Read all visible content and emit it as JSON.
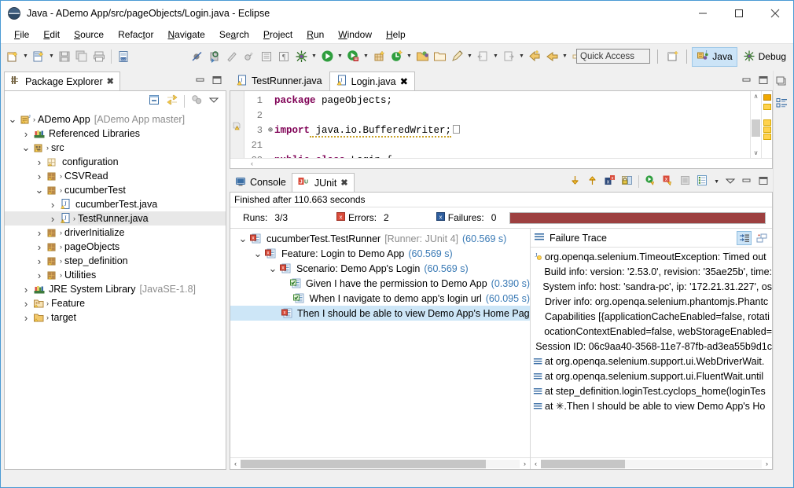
{
  "window": {
    "title": "Java - ADemo App/src/pageObjects/Login.java - Eclipse",
    "app_icon": "eclipse-icon",
    "minimize": "—",
    "maximize": "□",
    "close": "✕"
  },
  "menu": {
    "items": [
      {
        "label": "File",
        "mnemonic": "F"
      },
      {
        "label": "Edit",
        "mnemonic": "E"
      },
      {
        "label": "Source",
        "mnemonic": "S"
      },
      {
        "label": "Refactor",
        "mnemonic": "t"
      },
      {
        "label": "Navigate",
        "mnemonic": "N"
      },
      {
        "label": "Search",
        "mnemonic": "a"
      },
      {
        "label": "Project",
        "mnemonic": "P"
      },
      {
        "label": "Run",
        "mnemonic": "R"
      },
      {
        "label": "Window",
        "mnemonic": "W"
      },
      {
        "label": "Help",
        "mnemonic": "H"
      }
    ]
  },
  "toolbar": {
    "icons": [
      "new-wizard-icon",
      "new-java-class-icon",
      "save-icon",
      "save-all-icon",
      "print-icon",
      "new-java-file-icon",
      "toggle-breakpoint-icon",
      "skip-breakpoints-icon",
      "build-icon",
      "build-all-icon",
      "open-type-icon",
      "open-task-icon",
      "debug-icon",
      "run-icon",
      "run-last-tool-icon",
      "coverage-icon",
      "new-package-icon",
      "open-project-icon",
      "close-project-icon",
      "search-icon",
      "next-annotation-icon",
      "previous-annotation-icon",
      "last-edit-location-icon",
      "back-icon",
      "forward-icon"
    ],
    "quick_access": {
      "placeholder": "Quick Access",
      "value": "Quick Access"
    },
    "open_perspective_icon": "open-perspective-icon",
    "perspectives": [
      {
        "label": "Java",
        "icon": "java-perspective-icon",
        "active": true
      },
      {
        "label": "Debug",
        "icon": "debug-perspective-icon",
        "active": false
      }
    ]
  },
  "package_explorer": {
    "tab": {
      "label": "Package Explorer",
      "icon": "package-explorer-icon",
      "close": "✖"
    },
    "tab_buttons": [
      "minimize-icon",
      "maximize-icon"
    ],
    "toolbar_icons": [
      "collapse-all-icon",
      "link-with-editor-icon",
      "view-menu-filter-icon",
      "view-menu-icon"
    ],
    "tree": [
      {
        "indent": 0,
        "twist": "down",
        "icon": "java-project-icon",
        "arrow": true,
        "label": "ADemo App",
        "sub": "[ADemo App master]",
        "selected": false
      },
      {
        "indent": 1,
        "twist": "right",
        "icon": "referenced-libraries-icon",
        "arrow": false,
        "label": "Referenced Libraries",
        "sub": "",
        "selected": false
      },
      {
        "indent": 1,
        "twist": "down",
        "icon": "source-folder-icon",
        "arrow": true,
        "label": "src",
        "sub": "",
        "selected": false
      },
      {
        "indent": 2,
        "twist": "right",
        "icon": "package-empty-icon",
        "arrow": false,
        "label": "configuration",
        "sub": "",
        "selected": false
      },
      {
        "indent": 2,
        "twist": "right",
        "icon": "package-icon",
        "arrow": true,
        "label": "CSVRead",
        "sub": "",
        "selected": false
      },
      {
        "indent": 2,
        "twist": "down",
        "icon": "package-icon",
        "arrow": true,
        "label": "cucumberTest",
        "sub": "",
        "selected": false
      },
      {
        "indent": 3,
        "twist": "right",
        "icon": "java-file-icon",
        "arrow": false,
        "label": "cucumberTest.java",
        "sub": "",
        "selected": false
      },
      {
        "indent": 3,
        "twist": "right",
        "icon": "java-file-warning-icon",
        "arrow": true,
        "label": "TestRunner.java",
        "sub": "",
        "selected": true
      },
      {
        "indent": 2,
        "twist": "right",
        "icon": "package-icon",
        "arrow": true,
        "label": "driverInitialize",
        "sub": "",
        "selected": false
      },
      {
        "indent": 2,
        "twist": "right",
        "icon": "package-icon",
        "arrow": true,
        "label": "pageObjects",
        "sub": "",
        "selected": false
      },
      {
        "indent": 2,
        "twist": "right",
        "icon": "package-icon",
        "arrow": true,
        "label": "step_definition",
        "sub": "",
        "selected": false
      },
      {
        "indent": 2,
        "twist": "right",
        "icon": "package-icon",
        "arrow": true,
        "label": "Utilities",
        "sub": "",
        "selected": false
      },
      {
        "indent": 1,
        "twist": "right",
        "icon": "jre-library-icon",
        "arrow": false,
        "label": "JRE System Library",
        "sub": "[JavaSE-1.8]",
        "selected": false
      },
      {
        "indent": 1,
        "twist": "right",
        "icon": "folder-feature-icon",
        "arrow": true,
        "label": "Feature",
        "sub": "",
        "selected": false
      },
      {
        "indent": 1,
        "twist": "right",
        "icon": "folder-target-icon",
        "arrow": true,
        "label": "target",
        "sub": "",
        "selected": false
      }
    ]
  },
  "editor": {
    "tabs": [
      {
        "label": "TestRunner.java",
        "icon": "java-file-warning-icon",
        "active": false,
        "close": ""
      },
      {
        "label": "Login.java",
        "icon": "java-file-warning-icon",
        "active": true,
        "close": "✖"
      }
    ],
    "tab_buttons": [
      "minimize-icon",
      "maximize-icon"
    ],
    "lines": [
      {
        "num": "1",
        "fold": "",
        "marker": "",
        "tokens": [
          {
            "t": "package",
            "k": true
          },
          {
            "t": " pageObjects;",
            "k": false
          }
        ]
      },
      {
        "num": "2",
        "fold": "",
        "marker": "",
        "tokens": []
      },
      {
        "num": "3",
        "fold": "⊕",
        "marker": "warning-icon",
        "tokens": [
          {
            "t": "import",
            "k": true
          },
          {
            "t": " java.io.BufferedWriter;",
            "k": false,
            "squiggle": true
          }
        ],
        "collapsed_box": true
      },
      {
        "num": "21",
        "fold": "",
        "marker": "",
        "tokens": []
      },
      {
        "num": "22",
        "fold": "",
        "marker": "",
        "tokens": [
          {
            "t": "public class",
            "k": true
          },
          {
            "t": " Login {",
            "k": false
          }
        ]
      }
    ],
    "scrollbar": {
      "up": "∧",
      "down": "∨"
    },
    "hscroll_left": "‹"
  },
  "junit": {
    "tabs": [
      {
        "label": "Console",
        "icon": "console-icon",
        "active": false,
        "close": ""
      },
      {
        "label": "JUnit",
        "icon": "junit-icon",
        "active": true,
        "close": "✖"
      }
    ],
    "toolbar_icons": [
      "next-failure-icon",
      "previous-failure-icon",
      "show-failures-only-icon",
      "lock-scroll-icon",
      "rerun-test-icon",
      "rerun-failed-tests-icon",
      "stop-icon",
      "test-run-history-icon",
      "view-menu-icon",
      "minimize-icon",
      "maximize-icon"
    ],
    "status": "Finished after 110.663 seconds",
    "counters": [
      {
        "label": "Runs:",
        "value": "3/3",
        "icon": ""
      },
      {
        "label": "Errors:",
        "value": "2",
        "icon": "error-icon"
      },
      {
        "label": "Failures:",
        "value": "0",
        "icon": "failure-icon"
      }
    ],
    "progress_color": "#9d4040",
    "progress_percent": 100,
    "tree": [
      {
        "indent": 0,
        "twist": "down",
        "icon": "test-error-icon",
        "label": "cucumberTest.TestRunner",
        "meta": "[Runner: JUnit 4]",
        "time": "(60.569 s)",
        "selected": false
      },
      {
        "indent": 1,
        "twist": "down",
        "icon": "test-error-icon",
        "label": "Feature: Login to Demo App",
        "meta": "",
        "time": "(60.569 s)",
        "selected": false
      },
      {
        "indent": 2,
        "twist": "down",
        "icon": "test-error-icon",
        "label": "Scenario: Demo App's Login",
        "meta": "",
        "time": "(60.569 s)",
        "selected": false
      },
      {
        "indent": 3,
        "twist": "",
        "icon": "test-pass-icon",
        "label": "Given I have the permission to Demo App",
        "meta": "",
        "time": "(0.390 s)",
        "selected": false
      },
      {
        "indent": 3,
        "twist": "",
        "icon": "test-pass-icon",
        "label": "When I navigate to demo app's login url",
        "meta": "",
        "time": "(60.095 s)",
        "selected": false
      },
      {
        "indent": 3,
        "twist": "",
        "icon": "test-error-icon",
        "label": "Then I should be able to view Demo App's Home Page (",
        "meta": "",
        "time": "",
        "selected": true
      }
    ],
    "tree_hscroll": {
      "left": "‹",
      "right": "›",
      "thumb_percent": 88
    },
    "failure_trace": {
      "title": "Failure Trace",
      "icon": "failure-trace-icon",
      "buttons": [
        "filter-stack-trace-icon",
        "pin-trace-icon"
      ],
      "rows": [
        {
          "icon": "exception-icon",
          "text": "org.openqa.selenium.TimeoutException: Timed out"
        },
        {
          "icon": "",
          "text": "Build info: version: '2.53.0', revision: '35ae25b', time:"
        },
        {
          "icon": "",
          "text": "System info: host: 'sandra-pc', ip: '172.21.31.227', os"
        },
        {
          "icon": "",
          "text": "Driver info: org.openqa.selenium.phantomjs.Phantc"
        },
        {
          "icon": "",
          "text": "Capabilities [{applicationCacheEnabled=false, rotati"
        },
        {
          "icon": "",
          "text": "ocationContextEnabled=false, webStorageEnabled="
        },
        {
          "icon": "",
          "text": "Session ID: 06c9aa40-3568-11e7-87fb-ad3ea55b9d1c"
        },
        {
          "icon": "stack-frame-icon",
          "text": "at org.openqa.selenium.support.ui.WebDriverWait."
        },
        {
          "icon": "stack-frame-icon",
          "text": "at org.openqa.selenium.support.ui.FluentWait.until"
        },
        {
          "icon": "stack-frame-icon",
          "text": "at step_definition.loginTest.cyclops_home(loginTes"
        },
        {
          "icon": "stack-frame-icon",
          "text": "at ✳.Then I should be able to view Demo App's Ho"
        }
      ],
      "hscroll": {
        "left": "‹",
        "right": "›",
        "thumb_percent": 38
      }
    },
    "icon_strip": [
      "outline-icon"
    ]
  }
}
